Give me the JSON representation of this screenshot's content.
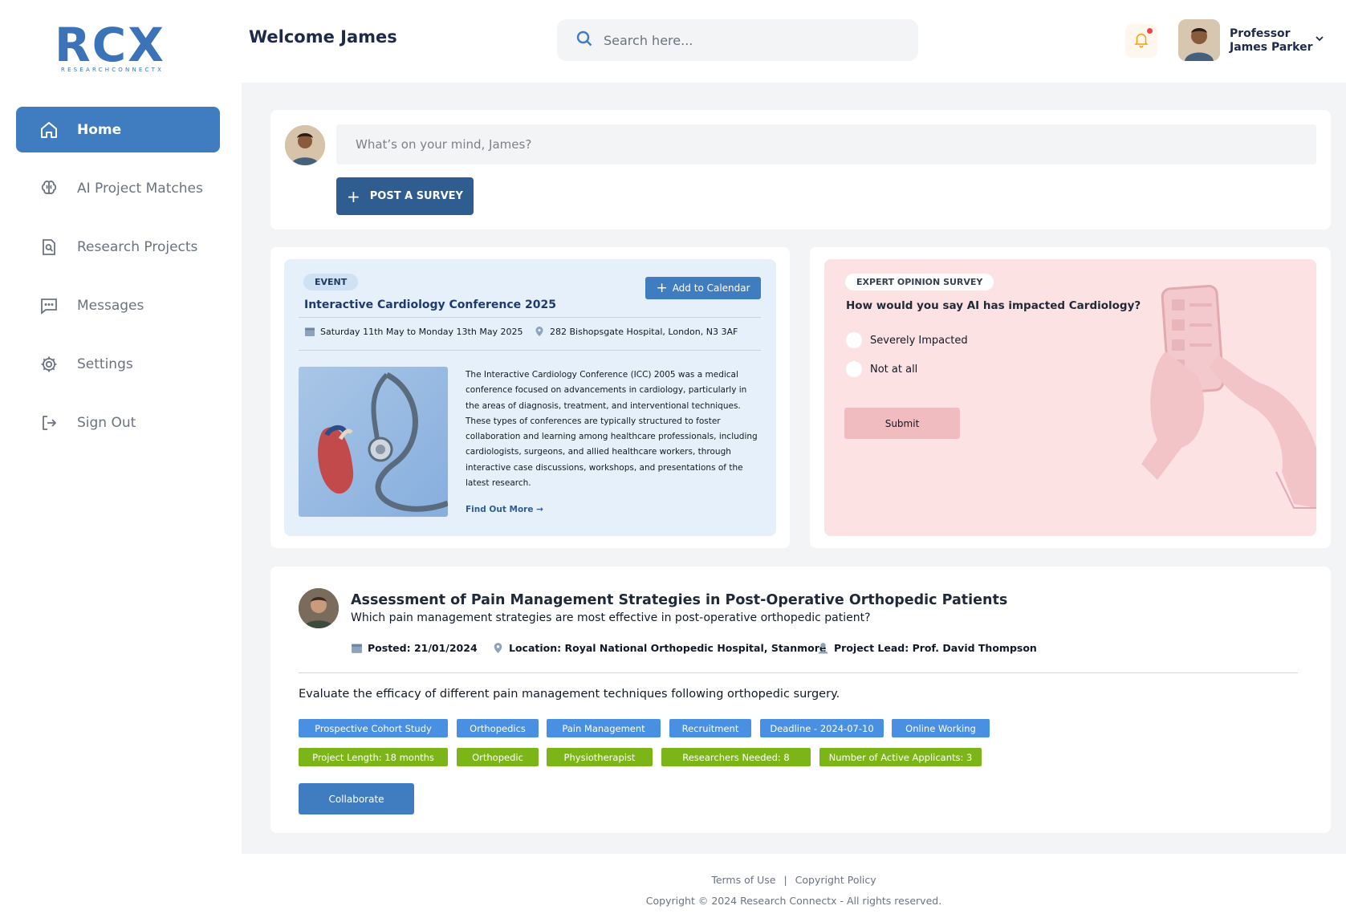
{
  "brand": {
    "logo_main": "RCX",
    "logo_sub": "RESEARCHCONNECTX",
    "color": "#3b72b8"
  },
  "header": {
    "welcome": "Welcome James",
    "search_placeholder": "Search here...",
    "notification_icon": "bell-icon",
    "profile_title": "Professor",
    "profile_name": "James Parker"
  },
  "sidebar": {
    "items": [
      {
        "label": "Home",
        "icon": "home-icon",
        "active": true
      },
      {
        "label": "AI Project Matches",
        "icon": "brain-icon",
        "active": false
      },
      {
        "label": "Research Projects",
        "icon": "document-search-icon",
        "active": false
      },
      {
        "label": "Messages",
        "icon": "message-icon",
        "active": false
      },
      {
        "label": "Settings",
        "icon": "gear-icon",
        "active": false
      },
      {
        "label": "Sign Out",
        "icon": "sign-out-icon",
        "active": false
      }
    ]
  },
  "composer": {
    "placeholder": "What’s on your mind, James?",
    "post_button": "POST A SURVEY"
  },
  "event": {
    "badge": "EVENT",
    "title": "Interactive Cardiology Conference 2025",
    "add_button": "Add to Calendar",
    "date": "Saturday 11th May to Monday 13th May 2025",
    "location": "282 Bishopsgate Hospital, London, N3 3AF",
    "description": "The Interactive Cardiology Conference (ICC) 2005 was a medical conference focused on advancements in cardiology, particularly in the areas of diagnosis, treatment, and interventional techniques. These types of conferences are typically structured to foster collaboration and learning among healthcare professionals, including cardiologists, surgeons, and allied healthcare workers, through interactive case discussions, workshops, and presentations of the latest research.",
    "link": "Find Out More"
  },
  "survey": {
    "badge": "EXPERT OPINION SURVEY",
    "question": "How would you say AI has impacted Cardiology?",
    "options": [
      "Severely Impacted",
      "Not at all"
    ],
    "submit": "Submit"
  },
  "project": {
    "title": "Assessment of Pain Management Strategies in Post-Operative Orthopedic Patients",
    "subtitle": "Which pain management strategies are most effective in post-operative orthopedic patient?",
    "posted": "Posted: 21/01/2024",
    "location": "Location: Royal National Orthopedic Hospital, Stanmore",
    "lead": "Project Lead: Prof. David Thompson",
    "description": "Evaluate the efficacy of different pain management techniques following orthopedic surgery.",
    "tags_blue": [
      "Prospective Cohort Study",
      "Orthopedics",
      "Pain Management",
      "Recruitment",
      "Deadline - 2024-07-10",
      "Online Working"
    ],
    "tags_green": [
      "Project Length: 18 months",
      "Orthopedic",
      "Physiotherapist",
      "Researchers Needed: 8",
      "Number of Active Applicants: 3"
    ],
    "collaborate": "Collaborate"
  },
  "footer": {
    "terms": "Terms of Use",
    "separator": "|",
    "copyright_policy": "Copyright Policy",
    "copyright": "Copyright © 2024 Research Connectx - All rights reserved."
  }
}
